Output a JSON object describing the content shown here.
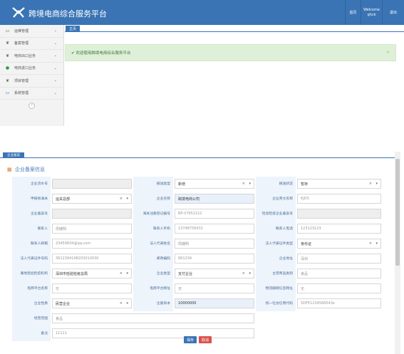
{
  "header": {
    "app_title": "跨境电商综合服务平台",
    "home_label": "首页",
    "welcome_label": "Welcome",
    "username": "qhck",
    "logout_label": "退出"
  },
  "sidebar": {
    "items": [
      {
        "label": "运维管理",
        "icon": "monitor-icon"
      },
      {
        "label": "备案管理",
        "icon": "leaf-icon"
      },
      {
        "label": "电商出口业务",
        "icon": "leaf-icon"
      },
      {
        "label": "电商进口业务",
        "icon": "circle-icon"
      },
      {
        "label": "项目管理",
        "icon": "leaf-icon"
      },
      {
        "label": "系统管理",
        "icon": "monitor-icon"
      }
    ],
    "collapse_icon": "«"
  },
  "tabs": {
    "home": "主页"
  },
  "welcome": {
    "message": "✔ 欢迎使用跨境电商综合服务平台",
    "close": "×"
  },
  "form_frame": {
    "tab_label": "企业备案",
    "section_title": "企业备案信息",
    "rows": [
      [
        {
          "label": "企业流水号",
          "value": "",
          "style": "dis"
        },
        {
          "label": "报送类型",
          "value": "新增",
          "type": "select",
          "style": "dark"
        },
        {
          "label": "报送状态",
          "value": "暂存",
          "type": "select",
          "style": "dark"
        }
      ],
      [
        {
          "label": "申报地海关",
          "value": "运关总部",
          "type": "select",
          "style": "dark"
        },
        {
          "label": "企业名称",
          "value": "跨境电商公司",
          "style": "hl dark"
        },
        {
          "label": "企业英文名称",
          "value": "KJDS"
        }
      ],
      [
        {
          "label": "企业备案号",
          "value": "",
          "style": "dis"
        },
        {
          "label": "海关注册登记编号",
          "value": "BP-07652212"
        },
        {
          "label": "检验检疫企业备案号",
          "value": "",
          "style": "dis"
        }
      ],
      [
        {
          "label": "联系人",
          "value": "周婕明"
        },
        {
          "label": "联系人手机",
          "value": "13748756431"
        },
        {
          "label": "联系人电话",
          "value": "123123123"
        }
      ],
      [
        {
          "label": "联系人邮箱",
          "value": "23459834@qq.com"
        },
        {
          "label": "法人代表姓名",
          "value": "周婕明"
        },
        {
          "label": "法人代表证件类型",
          "value": "身份证",
          "type": "select",
          "style": "dark"
        }
      ],
      [
        {
          "label": "法人代表证件号码",
          "value": "36123941982030100​30"
        },
        {
          "label": "邮政编码",
          "value": "661234"
        },
        {
          "label": "企业地址",
          "value": "深圳"
        }
      ],
      [
        {
          "label": "属地检验检疫机构",
          "value": "深圳市检验检疫总局",
          "type": "select",
          "style": "dark"
        },
        {
          "label": "企业类型",
          "value": "支付企业",
          "type": "select",
          "style": "dark"
        },
        {
          "label": "主营商品类别",
          "value": "食品"
        }
      ],
      [
        {
          "label": "电商平台名称",
          "value": "无"
        },
        {
          "label": "电商平台网址",
          "value": "无"
        },
        {
          "label": "物流跟踪信息网址",
          "value": "无"
        }
      ],
      [
        {
          "label": "企业性质",
          "value": "民营企业",
          "type": "select",
          "style": "dark"
        },
        {
          "label": "注册资本",
          "value": "10000000",
          "style": "hl dark"
        },
        {
          "label": "统一社会信用代码",
          "value": "5DFE1234568543e"
        }
      ]
    ],
    "business_scope": {
      "label": "经营范围",
      "value": "食品"
    },
    "remarks": {
      "label": "备注",
      "value": "11111"
    },
    "save_label": "保存",
    "cancel_label": "取消"
  }
}
